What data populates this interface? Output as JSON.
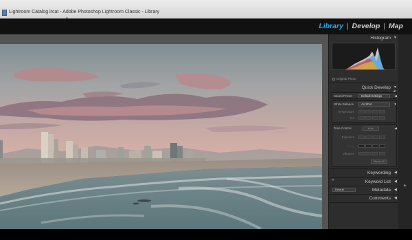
{
  "window": {
    "title": "Lightroom Catalog.lrcat - Adobe Photoshop Lightroom Classic - Library"
  },
  "modules": [
    {
      "label": "Library",
      "active": true
    },
    {
      "label": "Develop",
      "active": false
    },
    {
      "label": "Map",
      "active": false
    }
  ],
  "panel": {
    "histogram": {
      "header": "Histogram",
      "original_photo_label": "Original Photo"
    },
    "quick_develop": {
      "header": "Quick Develop",
      "saved_preset_label": "Saved Preset",
      "saved_preset_value": "Default Settings",
      "white_balance_label": "White Balance",
      "white_balance_value": "As Shot",
      "temperature_label": "Temperature",
      "tint_label": "Tint",
      "tone_control_label": "Tone Control",
      "auto_label": "Auto",
      "exposure_label": "Exposure",
      "clarity_label": "Clarity",
      "vibrance_label": "Vibrance",
      "reset_label": "Reset All"
    },
    "keywording": {
      "header": "Keywording"
    },
    "keyword_list": {
      "header": "Keyword List",
      "plus": "+"
    },
    "metadata": {
      "header": "Metadata",
      "preset_value": "Default"
    },
    "comments": {
      "header": "Comments"
    }
  },
  "colors": {
    "accent": "#2fa7ea",
    "panel_bg": "#2d2d2d",
    "main_bg": "#545454"
  },
  "icons": {
    "document": "document-icon",
    "collapse": "triangle-down-icon",
    "expand": "triangle-left-icon"
  }
}
